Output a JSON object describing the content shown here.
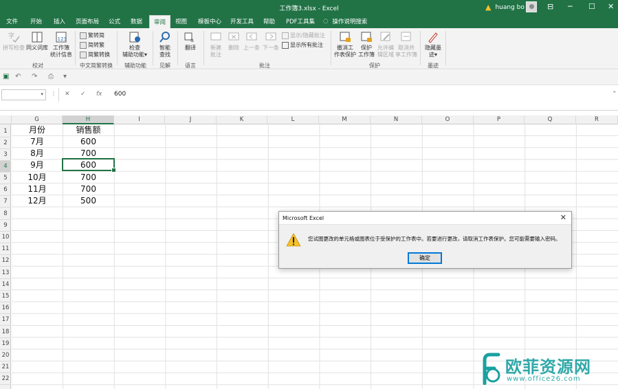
{
  "titlebar": {
    "title": "工作簿3.xlsx  -  Excel",
    "user_name": "huang bo",
    "minimize_glyph": "─",
    "restore_glyph": "☐",
    "close_glyph": "✕",
    "ribbon_display_glyph": "⊟"
  },
  "tabs": [
    "文件",
    "开始",
    "插入",
    "页面布局",
    "公式",
    "数据",
    "审阅",
    "视图",
    "模板中心",
    "开发工具",
    "帮助",
    "PDF工具集"
  ],
  "active_tab": "审阅",
  "tell_me": "操作说明搜索",
  "ribbon": {
    "spelling": "拼写检查",
    "thesaurus": "同义词库",
    "workbook_stats_1": "工作簿",
    "workbook_stats_2": "统计信息",
    "group_proofing": "校对",
    "to_simplified": "繁转简",
    "to_traditional": "简转繁",
    "convert": "简繁转换",
    "group_chinese": "中文简繁转换",
    "check_access_1": "检查",
    "check_access_2": "辅助功能",
    "group_access": "辅助功能",
    "smart_lookup_1": "智能",
    "smart_lookup_2": "查找",
    "group_insights": "见解",
    "translate": "翻译",
    "group_language": "语言",
    "new_comment_1": "新建",
    "new_comment_2": "批注",
    "delete": "删除",
    "previous": "上一条",
    "next": "下一条",
    "show_hide_comment": "显示/隐藏批注",
    "show_all_comments": "显示所有批注",
    "group_comments": "批注",
    "unprotect_sheet_1": "撤消工",
    "unprotect_sheet_2": "作表保护",
    "protect_workbook_1": "保护",
    "protect_workbook_2": "工作簿",
    "allow_edit_1": "允许编",
    "allow_edit_2": "辑区域",
    "unshare_1": "取消共",
    "unshare_2": "享工作簿",
    "group_protect": "保护",
    "hide_ink_1": "隐藏墨",
    "hide_ink_2": "迹",
    "group_ink": "墨迹"
  },
  "formula_bar": {
    "name_box": "",
    "cancel_glyph": "✕",
    "enter_glyph": "✓",
    "fx_label": "fx",
    "value": "600"
  },
  "grid": {
    "columns": [
      "G",
      "H",
      "I",
      "J",
      "K",
      "L",
      "M",
      "N",
      "O",
      "P",
      "Q",
      "R"
    ],
    "rows": [
      "1",
      "2",
      "3",
      "4",
      "5",
      "6",
      "7",
      "8",
      "9",
      "10",
      "11",
      "12",
      "13",
      "14",
      "15",
      "16",
      "17",
      "18",
      "19",
      "20",
      "21",
      "22"
    ],
    "selected_column": "H",
    "selected_row": "4",
    "data": [
      [
        "月份",
        "销售额"
      ],
      [
        "7月",
        "600"
      ],
      [
        "8月",
        "700"
      ],
      [
        "9月",
        "600"
      ],
      [
        "10月",
        "700"
      ],
      [
        "11月",
        "700"
      ],
      [
        "12月",
        "500"
      ]
    ]
  },
  "dialog": {
    "title": "Microsoft Excel",
    "message": "您试图更改的单元格或图表位于受保护的工作表中。若要进行更改，请取消工作表保护。您可能需要输入密码。",
    "ok": "确定"
  },
  "watermark": {
    "text": "欧菲资源网",
    "url": "www.office26.com"
  },
  "colors": {
    "excel_green": "#217346",
    "watermark_teal": "#1aa0a0",
    "warning_yellow": "#f6c12c"
  }
}
